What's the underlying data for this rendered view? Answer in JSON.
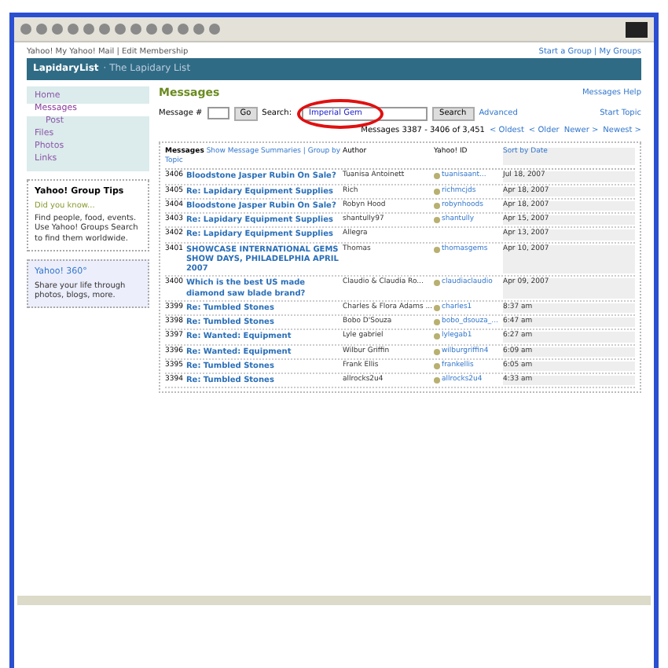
{
  "top_links": {
    "left": "Yahoo! My Yahoo! Mail | Edit Membership",
    "right": "Start a Group | My Groups"
  },
  "banner": {
    "name": "LapidaryList",
    "tagline": "· The Lapidary List"
  },
  "sidebar": {
    "items": [
      {
        "label": "Home",
        "selected": false,
        "sub": false
      },
      {
        "label": "Messages",
        "selected": true,
        "sub": false
      },
      {
        "label": "Post",
        "selected": false,
        "sub": true
      },
      {
        "label": "Files",
        "selected": false,
        "sub": false
      },
      {
        "label": "Photos",
        "selected": false,
        "sub": false
      },
      {
        "label": "Links",
        "selected": false,
        "sub": false
      }
    ],
    "tips": {
      "title": "Yahoo! Group Tips",
      "subtitle": "Did you know...",
      "text": "Find people, food, events. Use Yahoo! Groups Search to find them worldwide."
    },
    "promo": {
      "title": "Yahoo! 360°",
      "text": "Share your life through photos, blogs, more."
    }
  },
  "main": {
    "title": "Messages",
    "help": "Messages Help",
    "msg_label": "Message #",
    "go": "Go",
    "search_label": "Search:",
    "search_value": "Imperial Gem",
    "search_button": "Search",
    "advanced": "Advanced",
    "start_topic": "Start Topic",
    "paging": "Messages 3387 - 3406 of 3,451",
    "nav": [
      "< Oldest",
      "< Older",
      "Newer >",
      "Newest >"
    ],
    "columns": {
      "messages": "Messages",
      "summaries": "Show Message Summaries | Group by Topic",
      "author": "Author",
      "yahoo_id": "Yahoo! ID",
      "date": "Sort by Date"
    },
    "rows": [
      {
        "num": "3406",
        "subject": "Bloodstone Jasper Rubin On Sale?",
        "author": "Tuanisa Antoinett",
        "yid": "tuanisaant...",
        "date": "Jul 18, 2007"
      },
      {
        "num": "3405",
        "subject": "Re: Lapidary Equipment Supplies",
        "author": "Rich",
        "yid": "richmcjds",
        "date": "Apr 18, 2007"
      },
      {
        "num": "3404",
        "subject": "Bloodstone Jasper Rubin On Sale?",
        "author": "Robyn Hood",
        "yid": "robynhoods",
        "date": "Apr 18, 2007"
      },
      {
        "num": "3403",
        "subject": "Re: Lapidary Equipment Supplies",
        "author": "shantully97",
        "yid": "shantully",
        "date": "Apr 15, 2007"
      },
      {
        "num": "3402",
        "subject": "Re: Lapidary Equipment Supplies",
        "author": "Allegra",
        "yid": "",
        "date": "Apr 13, 2007"
      },
      {
        "num": "3401",
        "subject": "SHOWCASE INTERNATIONAL GEMS SHOW DAYS, PHILADELPHIA APRIL 2007",
        "author": "Thomas",
        "yid": "thomasgems",
        "date": "Apr 10, 2007"
      },
      {
        "num": "3400",
        "subject": "Which is the best US made diamond saw blade brand?",
        "author": "Claudio & Claudia Ro...",
        "yid": "claudiaclaudio",
        "date": "Apr 09, 2007"
      },
      {
        "num": "3399",
        "subject": "Re: Tumbled Stones",
        "author": "Charles & Flora Adams ...",
        "yid": "charles1",
        "date": "8:37 am"
      },
      {
        "num": "3398",
        "subject": "Re: Tumbled Stones",
        "author": "Bobo D'Souza",
        "yid": "bobo_dsouza_...",
        "date": "6:47 am"
      },
      {
        "num": "3397",
        "subject": "Re: Wanted: Equipment",
        "author": "Lyle gabriel",
        "yid": "lylegab1",
        "date": "6:27 am"
      },
      {
        "num": "3396",
        "subject": "Re: Wanted: Equipment",
        "author": "Wilbur Griffin",
        "yid": "wilburgriffin4",
        "date": "6:09 am"
      },
      {
        "num": "3395",
        "subject": "Re: Tumbled Stones",
        "author": "Frank Ellis",
        "yid": "frankellis",
        "date": "6:05 am"
      },
      {
        "num": "3394",
        "subject": "Re: Tumbled Stones",
        "author": "allrocks2u4",
        "yid": "allrocks2u4",
        "date": "4:33 am"
      }
    ]
  }
}
